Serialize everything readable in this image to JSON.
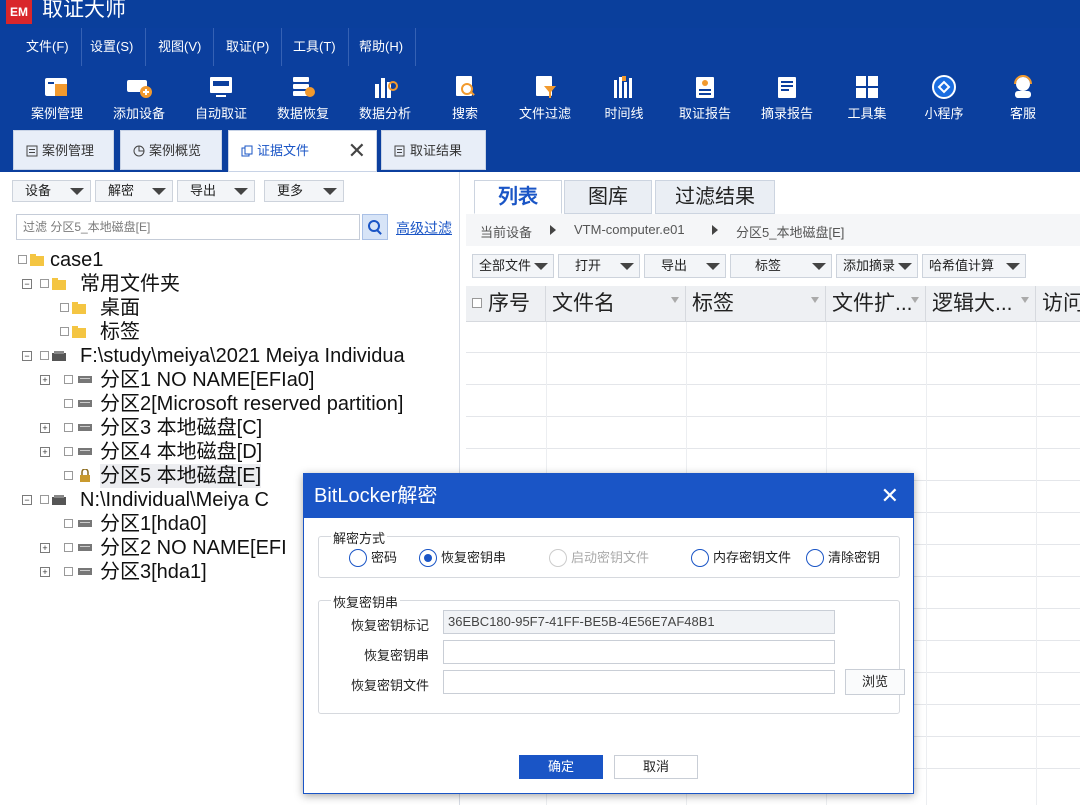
{
  "app": {
    "title": "取证大师",
    "logo_text": "EM"
  },
  "menu": [
    "文件(F)",
    "设置(S)",
    "视图(V)",
    "取证(P)",
    "工具(T)",
    "帮助(H)"
  ],
  "toolbar": [
    "案例管理",
    "添加设备",
    "自动取证",
    "数据恢复",
    "数据分析",
    "搜索",
    "文件过滤",
    "时间线",
    "取证报告",
    "摘录报告",
    "工具集",
    "小程序",
    "客服"
  ],
  "tabs": [
    "案例管理",
    "案例概览",
    "证据文件",
    "取证结果"
  ],
  "left": {
    "buttons": [
      "设备",
      "解密",
      "导出",
      "更多"
    ],
    "filter_text": "过滤 分区5_本地磁盘[E]",
    "advanced_filter": "高级过滤",
    "tree": [
      "case1",
      "常用文件夹",
      "桌面",
      "标签",
      "F:\\study\\meiya\\2021  Meiya  Individua",
      "分区1  NO NAME[EFIa0]",
      "分区2[Microsoft reserved partition]",
      "分区3  本地磁盘[C]",
      "分区4  本地磁盘[D]",
      "分区5  本地磁盘[E]",
      "N:\\Individual\\Meiya C",
      "分区1[hda0]",
      "分区2  NO NAME[EFI",
      "分区3[hda1]"
    ]
  },
  "right": {
    "tabs": [
      "列表",
      "图库",
      "过滤结果"
    ],
    "breadcrumb": [
      "当前设备",
      "VTM-computer.e01",
      "分区5_本地磁盘[E]"
    ],
    "buttons": [
      "全部文件",
      "打开",
      "导出",
      "标签",
      "添加摘录",
      "哈希值计算"
    ],
    "columns": [
      "序号",
      "文件名",
      "标签",
      "文件扩...",
      "逻辑大...",
      "访问"
    ]
  },
  "dialog": {
    "title": "BitLocker解密",
    "method_group": "解密方式",
    "methods": [
      "密码",
      "恢复密钥串",
      "启动密钥文件",
      "内存密钥文件",
      "清除密钥"
    ],
    "selected_method": "恢复密钥串",
    "key_group": "恢复密钥串",
    "id_label": "恢复密钥标记",
    "id_value": "36EBC180-95F7-41FF-BE5B-4E56E7AF48B1",
    "key_label": "恢复密钥串",
    "key_value": "",
    "file_label": "恢复密钥文件",
    "file_value": "",
    "browse": "浏览",
    "ok": "确定",
    "cancel": "取消"
  },
  "colors": {
    "brand": "#0b3f9e",
    "accent": "#1a55c6"
  }
}
